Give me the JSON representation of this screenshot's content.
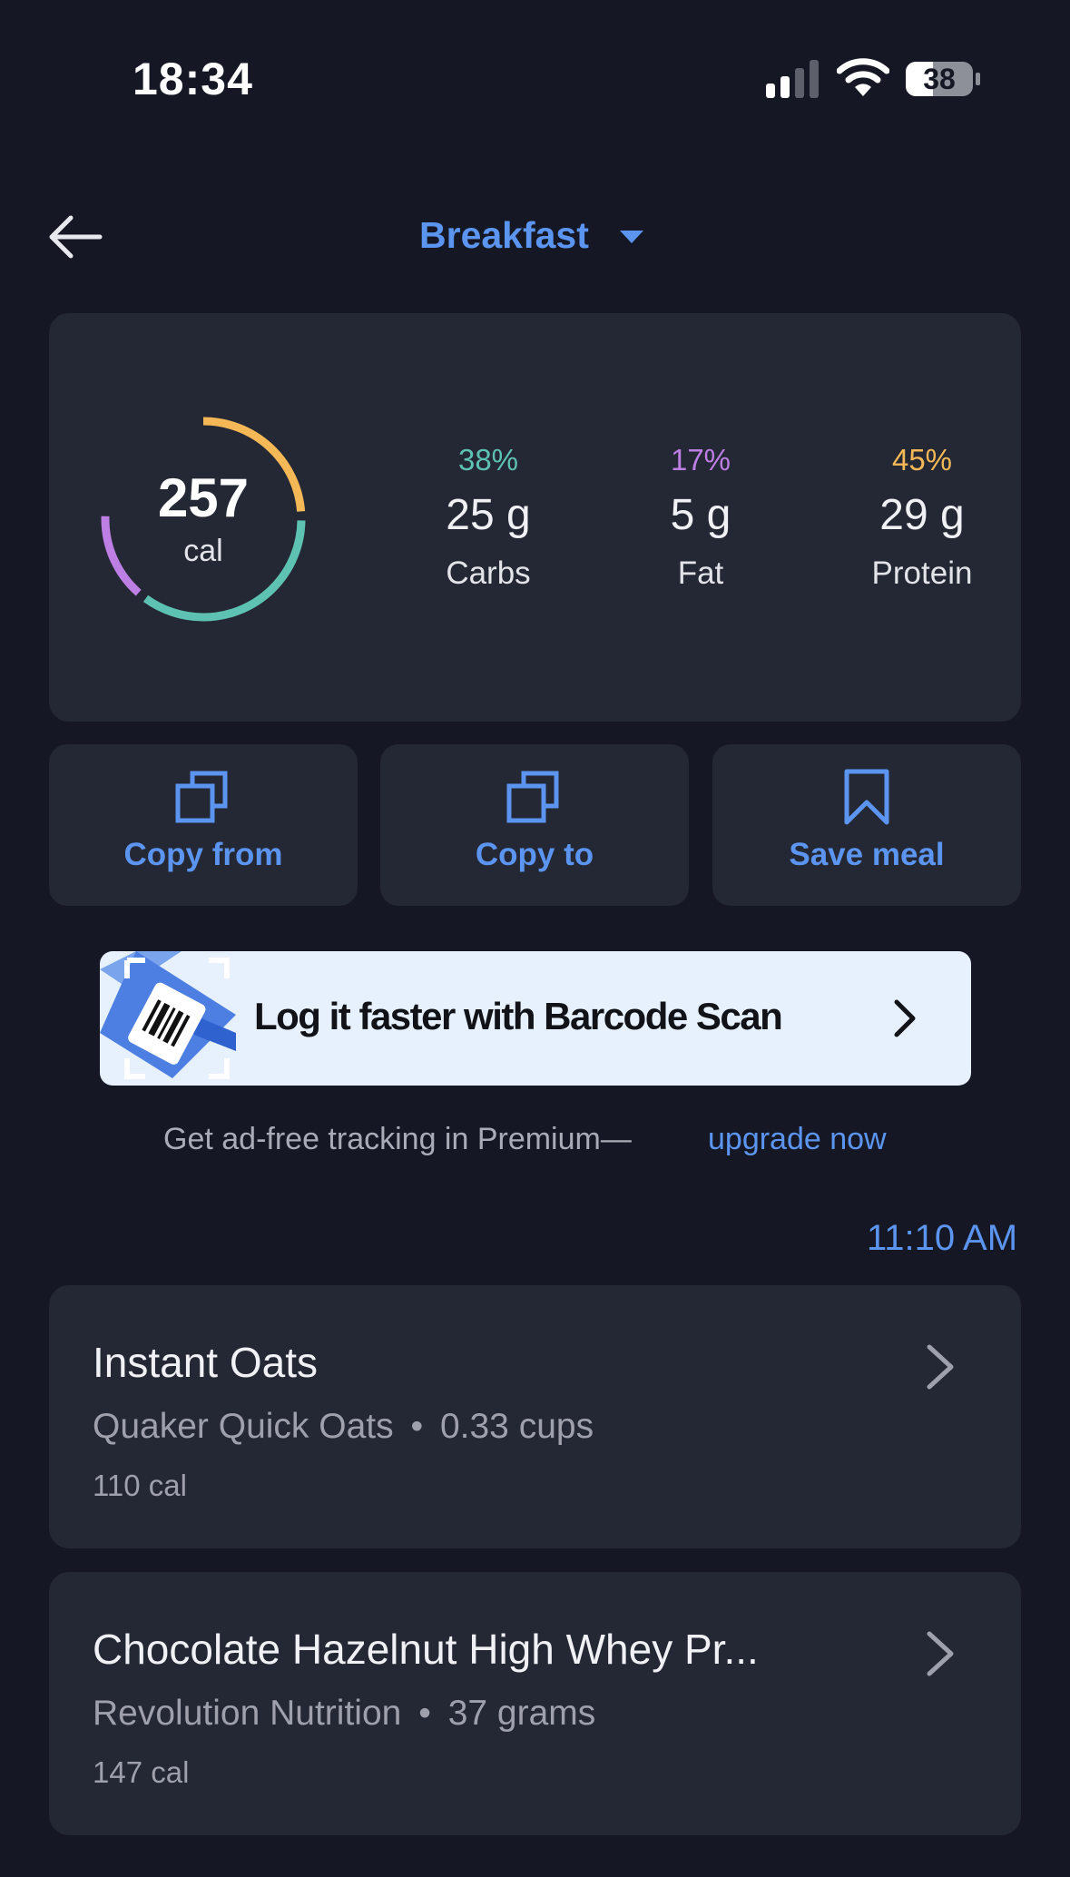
{
  "status_bar": {
    "time": "18:34",
    "battery": "38"
  },
  "header": {
    "meal": "Breakfast"
  },
  "summary": {
    "calories": "257",
    "calories_unit": "cal",
    "macros": [
      {
        "percent": "38%",
        "grams": "25 g",
        "name": "Carbs",
        "color": "#5ec2b3"
      },
      {
        "percent": "17%",
        "grams": "5 g",
        "name": "Fat",
        "color": "#bd7fe3"
      },
      {
        "percent": "45%",
        "grams": "29 g",
        "name": "Protein",
        "color": "#f5b856"
      }
    ]
  },
  "actions": {
    "copy_from": "Copy from",
    "copy_to": "Copy to",
    "save_meal": "Save meal"
  },
  "banner": {
    "text": "Log it faster with Barcode Scan"
  },
  "premium": {
    "note": "Get ad-free tracking in Premium—",
    "link": "upgrade now"
  },
  "log_time": "11:10 AM",
  "entries": [
    {
      "name": "Instant Oats",
      "brand": "Quaker Quick Oats",
      "serving": "0.33 cups",
      "calories": "110 cal"
    },
    {
      "name": "Chocolate Hazelnut High Whey Pr...",
      "brand": "Revolution Nutrition",
      "serving": "37 grams",
      "calories": "147 cal"
    }
  ],
  "entry_separator": "•",
  "colors": {
    "background": "#151824",
    "card": "#242734",
    "accent": "#5b95f0"
  }
}
